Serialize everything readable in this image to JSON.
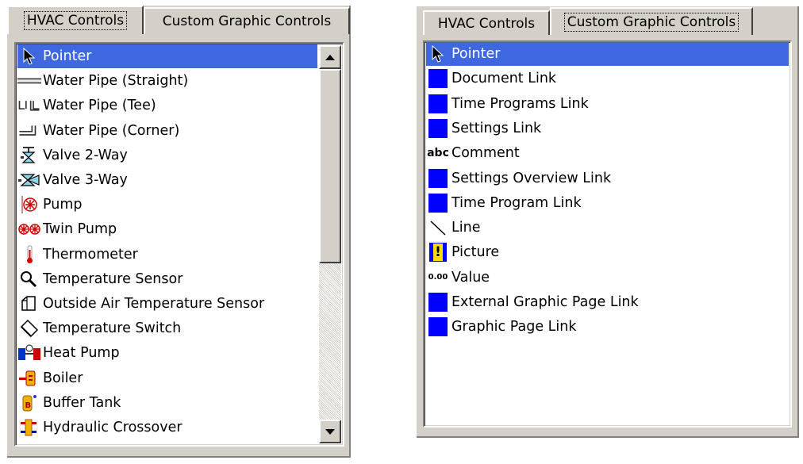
{
  "left_panel": {
    "tabs": [
      {
        "label": "HVAC Controls",
        "active": true
      },
      {
        "label": "Custom Graphic Controls",
        "active": false
      }
    ],
    "items": [
      {
        "label": "Pointer",
        "icon": "pointer-icon",
        "selected": true
      },
      {
        "label": "Water Pipe (Straight)",
        "icon": "water-pipe-straight-icon"
      },
      {
        "label": "Water Pipe (Tee)",
        "icon": "water-pipe-tee-icon"
      },
      {
        "label": "Water Pipe (Corner)",
        "icon": "water-pipe-corner-icon"
      },
      {
        "label": "Valve 2-Way",
        "icon": "valve-2way-icon"
      },
      {
        "label": "Valve 3-Way",
        "icon": "valve-3way-icon"
      },
      {
        "label": "Pump",
        "icon": "pump-icon"
      },
      {
        "label": "Twin Pump",
        "icon": "twin-pump-icon"
      },
      {
        "label": "Thermometer",
        "icon": "thermometer-icon"
      },
      {
        "label": "Temperature Sensor",
        "icon": "temperature-sensor-icon"
      },
      {
        "label": "Outside Air Temperature Sensor",
        "icon": "outside-air-sensor-icon"
      },
      {
        "label": "Temperature Switch",
        "icon": "temperature-switch-icon"
      },
      {
        "label": "Heat Pump",
        "icon": "heat-pump-icon"
      },
      {
        "label": "Boiler",
        "icon": "boiler-icon"
      },
      {
        "label": "Buffer Tank",
        "icon": "buffer-tank-icon"
      },
      {
        "label": "Hydraulic Crossover",
        "icon": "hydraulic-crossover-icon"
      }
    ],
    "scrollbar": {
      "up_icon": "arrow-up-icon",
      "down_icon": "arrow-down-icon",
      "thumb_position": 0.0,
      "visible_fraction": 0.55
    }
  },
  "right_panel": {
    "tabs": [
      {
        "label": "HVAC Controls",
        "active": false
      },
      {
        "label": "Custom Graphic Controls",
        "active": true
      }
    ],
    "items": [
      {
        "label": "Pointer",
        "icon": "pointer-icon",
        "selected": true
      },
      {
        "label": "Document Link",
        "icon": "blue-square-icon"
      },
      {
        "label": "Time Programs Link",
        "icon": "blue-square-icon"
      },
      {
        "label": "Settings Link",
        "icon": "blue-square-icon"
      },
      {
        "label": "Comment",
        "icon": "abc-text-icon",
        "icon_text": "abc"
      },
      {
        "label": "Settings Overview Link",
        "icon": "blue-square-icon"
      },
      {
        "label": "Time Program Link",
        "icon": "blue-square-icon"
      },
      {
        "label": "Line",
        "icon": "diagonal-line-icon"
      },
      {
        "label": "Picture",
        "icon": "exclamation-picture-icon",
        "icon_text": "!"
      },
      {
        "label": "Value",
        "icon": "value-number-icon",
        "icon_text": "0.00"
      },
      {
        "label": "External Graphic Page Link",
        "icon": "blue-square-icon"
      },
      {
        "label": "Graphic Page Link",
        "icon": "blue-square-icon"
      }
    ]
  },
  "colors": {
    "selection": "#3f68e0",
    "panel": "#d4d0c8",
    "link_square": "#0000ff"
  }
}
